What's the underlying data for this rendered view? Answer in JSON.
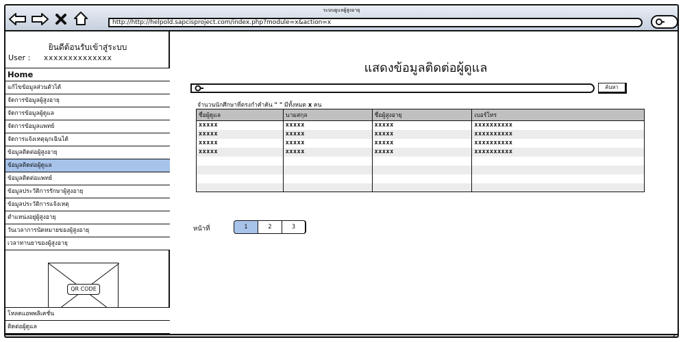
{
  "browser": {
    "window_title": "ระบบดูแลผู้สูงอายุ",
    "url": "http://http://helpold.sapcisproject.com/index.php?module=x&action=x"
  },
  "sidebar": {
    "welcome": "ยินดีต้อนรับเข้าสู่ระบบ",
    "user_label": "User :",
    "user_value": "xxxxxxxxxxxxxx",
    "items": [
      {
        "label": "Home"
      },
      {
        "label": "แก้ไขข้อมูลส่วนตัวได้"
      },
      {
        "label": "จัดการข้อมูลผู้สูงอายุ"
      },
      {
        "label": "จัดการข้อมูลผู้ดูแล"
      },
      {
        "label": "จัดการข้อมูลแพทย์"
      },
      {
        "label": "จัดการแจ้งเหตุฉุกเฉินได้"
      },
      {
        "label": "ข้อมูลติดต่อผู้สูงอายุ"
      },
      {
        "label": "ข้อมูลติดต่อผู้ดูแล"
      },
      {
        "label": "ข้อมูลติดต่อแพทย์"
      },
      {
        "label": "ข้อมูลประวัติการรักษาผู้สูงอายุ"
      },
      {
        "label": "ข้อมูลประวัติการแจ้งเหตุ"
      },
      {
        "label": "ตำแหน่งอยู่ผู้สูงอายุ"
      },
      {
        "label": "วันเวลาการนัดหมายของผู้สูงอายุ"
      },
      {
        "label": "เวลาทานยาของผู้สูงอายุ"
      }
    ],
    "active_index": 7,
    "qr_label": "QR CODE",
    "bottom_links": [
      {
        "label": "โหลดแอพพลิเคชั่น"
      },
      {
        "label": "ติดต่อผู้ดูแล"
      }
    ]
  },
  "main": {
    "title": "แสดงข้อมูลติดต่อผู้ดูแล",
    "search": {
      "placeholder": "",
      "button_label": "ค้นหา"
    },
    "result_prefix": "จำนวนนักศึกษาที่ตรงกำคำค้น",
    "result_quote": "\" \"",
    "result_mid": "มีทั้งหมด",
    "result_count": "x",
    "result_suffix": "คน",
    "table": {
      "headers": [
        "ชื่อผู้ดูแล",
        "นามสกุล",
        "ชื่อผู้สูงอายุ",
        "เบอร์โทร"
      ],
      "rows": [
        [
          "xxxxx",
          "xxxxx",
          "xxxxx",
          "xxxxxxxxxx"
        ],
        [
          "xxxxx",
          "xxxxx",
          "xxxxx",
          "xxxxxxxxxx"
        ],
        [
          "xxxxx",
          "xxxxx",
          "xxxxx",
          "xxxxxxxxxx"
        ],
        [
          "xxxxx",
          "xxxxx",
          "xxxxx",
          "xxxxxxxxxx"
        ],
        [
          "",
          "",
          "",
          ""
        ],
        [
          "",
          "",
          "",
          ""
        ],
        [
          "",
          "",
          "",
          ""
        ],
        [
          "",
          "",
          "",
          ""
        ]
      ]
    },
    "pager": {
      "label": "หน้าที่",
      "pages": [
        "1",
        "2",
        "3"
      ],
      "current": "1"
    }
  },
  "colors": {
    "active_item": "#a7c3ea",
    "table_header": "#c0c0c0",
    "row_alt": "#ececec"
  }
}
